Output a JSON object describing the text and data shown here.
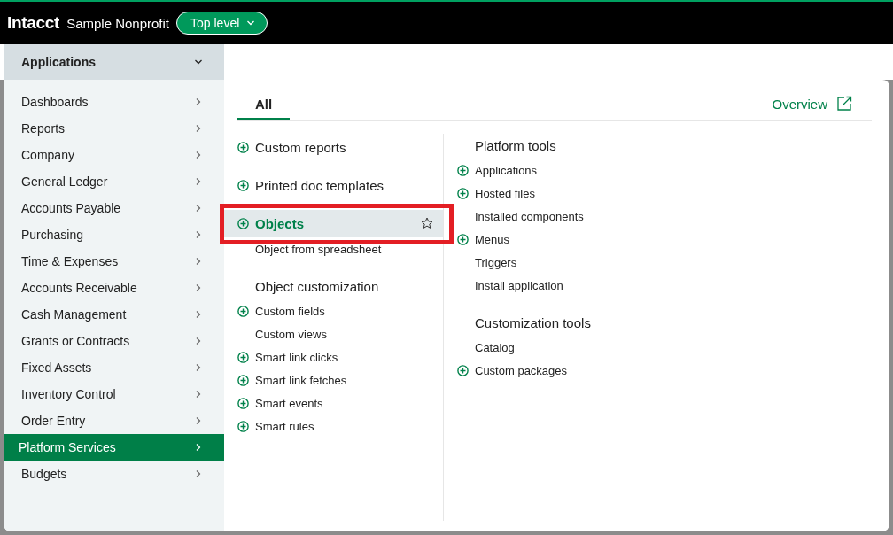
{
  "header": {
    "brand": "Intacct",
    "company": "Sample Nonprofit",
    "entity_button": "Top level"
  },
  "app_menu": {
    "label": "Applications",
    "expanded": true
  },
  "sidebar": {
    "items": [
      {
        "label": "Dashboards",
        "selected": false
      },
      {
        "label": "Reports",
        "selected": false
      },
      {
        "label": "Company",
        "selected": false
      },
      {
        "label": "General Ledger",
        "selected": false
      },
      {
        "label": "Accounts Payable",
        "selected": false
      },
      {
        "label": "Purchasing",
        "selected": false
      },
      {
        "label": "Time & Expenses",
        "selected": false
      },
      {
        "label": "Accounts Receivable",
        "selected": false
      },
      {
        "label": "Cash Management",
        "selected": false
      },
      {
        "label": "Grants or Contracts",
        "selected": false
      },
      {
        "label": "Fixed Assets",
        "selected": false
      },
      {
        "label": "Inventory Control",
        "selected": false
      },
      {
        "label": "Order Entry",
        "selected": false
      },
      {
        "label": "Platform Services",
        "selected": true
      },
      {
        "label": "Budgets",
        "selected": false
      }
    ]
  },
  "content": {
    "tabs": [
      {
        "label": "All",
        "selected": true
      }
    ],
    "overview_link": "Overview",
    "columns": [
      {
        "entries": [
          {
            "kind": "primary",
            "label": "Custom reports",
            "add": true,
            "selected": false,
            "outlined": false
          },
          {
            "kind": "primary",
            "label": "Printed doc templates",
            "add": true,
            "selected": false,
            "outlined": false
          },
          {
            "kind": "primary",
            "label": "Objects",
            "add": true,
            "selected": true,
            "outlined": true
          },
          {
            "kind": "link",
            "label": "Object from spreadsheet",
            "add": false
          },
          {
            "kind": "heading",
            "label": "Object customization"
          },
          {
            "kind": "link",
            "label": "Custom fields",
            "add": true
          },
          {
            "kind": "link",
            "label": "Custom views",
            "add": false
          },
          {
            "kind": "link",
            "label": "Smart link clicks",
            "add": true
          },
          {
            "kind": "link",
            "label": "Smart link fetches",
            "add": true
          },
          {
            "kind": "link",
            "label": "Smart events",
            "add": true
          },
          {
            "kind": "link",
            "label": "Smart rules",
            "add": true
          }
        ]
      },
      {
        "entries": [
          {
            "kind": "heading",
            "label": "Platform tools"
          },
          {
            "kind": "link",
            "label": "Applications",
            "add": true
          },
          {
            "kind": "link",
            "label": "Hosted files",
            "add": true
          },
          {
            "kind": "link",
            "label": "Installed components",
            "add": false
          },
          {
            "kind": "link",
            "label": "Menus",
            "add": true
          },
          {
            "kind": "link",
            "label": "Triggers",
            "add": false
          },
          {
            "kind": "link",
            "label": "Install application",
            "add": false
          },
          {
            "kind": "heading",
            "label": "Customization tools"
          },
          {
            "kind": "link",
            "label": "Catalog",
            "add": false
          },
          {
            "kind": "link",
            "label": "Custom packages",
            "add": true
          }
        ]
      }
    ]
  }
}
